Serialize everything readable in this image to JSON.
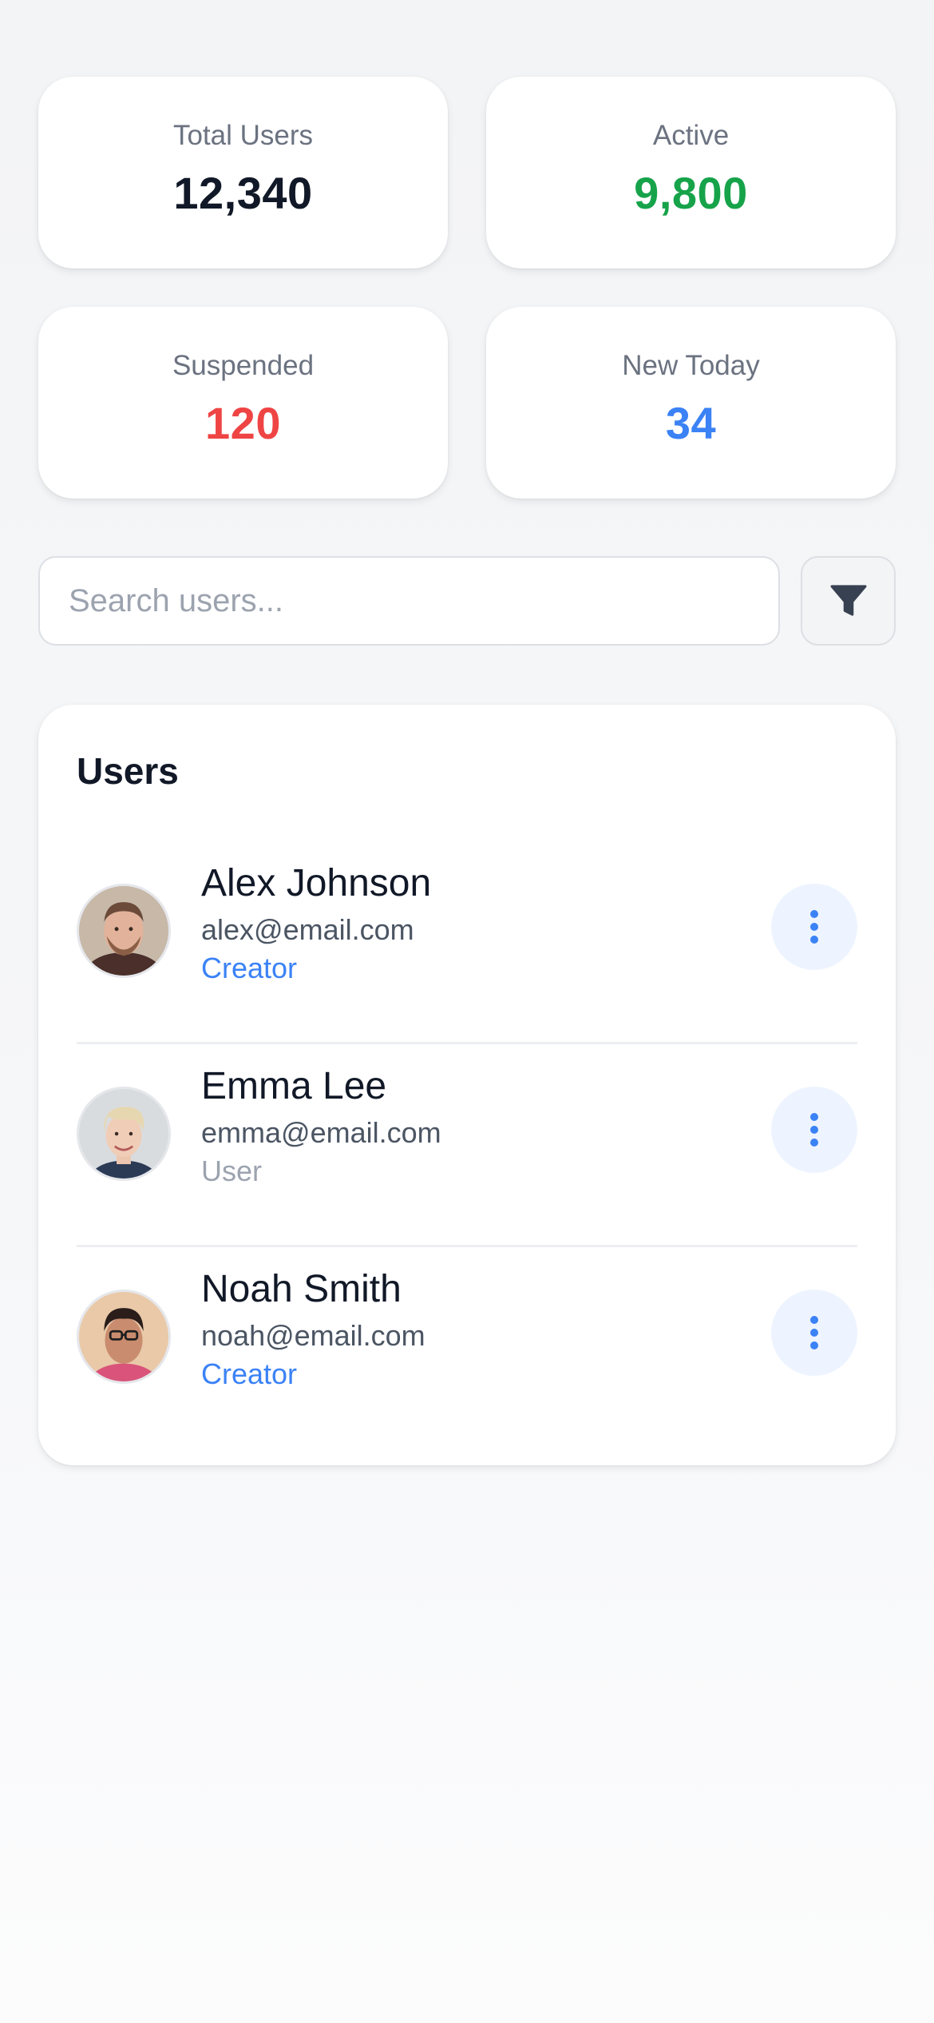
{
  "colors": {
    "green": "#16a34a",
    "red": "#ef4444",
    "blue": "#3b82f6",
    "dark": "#111827",
    "muted": "#9ca3af"
  },
  "stats": [
    {
      "label": "Total Users",
      "value": "12,340",
      "color": "#111827"
    },
    {
      "label": "Active",
      "value": "9,800",
      "color": "#16a34a"
    },
    {
      "label": "Suspended",
      "value": "120",
      "color": "#ef4444"
    },
    {
      "label": "New Today",
      "value": "34",
      "color": "#3b82f6"
    }
  ],
  "search": {
    "placeholder": "Search users...",
    "value": "",
    "filter_icon": "filter-icon"
  },
  "users_section": {
    "title": "Users",
    "more_icon": "more-vertical-icon",
    "users": [
      {
        "name": "Alex Johnson",
        "email": "alex@email.com",
        "role": "Creator",
        "role_color": "#3b82f6"
      },
      {
        "name": "Emma Lee",
        "email": "emma@email.com",
        "role": "User",
        "role_color": "#9ca3af"
      },
      {
        "name": "Noah Smith",
        "email": "noah@email.com",
        "role": "Creator",
        "role_color": "#3b82f6"
      }
    ]
  }
}
